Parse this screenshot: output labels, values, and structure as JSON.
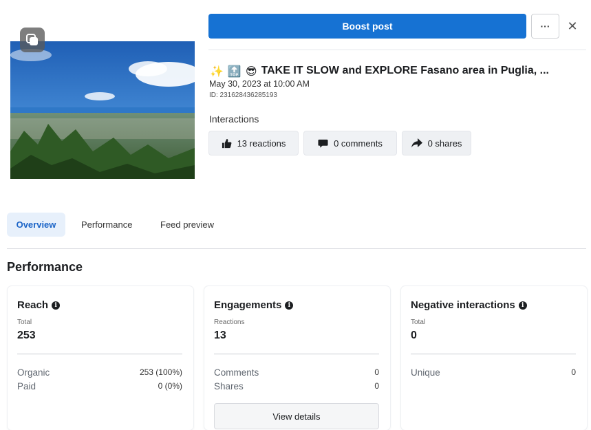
{
  "actions": {
    "boost_label": "Boost post",
    "more_label": "···",
    "close_label": "✕"
  },
  "post": {
    "emojis": [
      "✨",
      "🔝",
      "😎"
    ],
    "title": "TAKE IT SLOW and EXPLORE Fasano area in Puglia, ...",
    "date": "May 30, 2023 at 10:00 AM",
    "id": "ID: 231628436285193",
    "interactions_label": "Interactions",
    "reactions": "13 reactions",
    "comments": "0 comments",
    "shares": "0 shares"
  },
  "tabs": [
    {
      "label": "Overview",
      "active": true
    },
    {
      "label": "Performance",
      "active": false
    },
    {
      "label": "Feed preview",
      "active": false
    }
  ],
  "performance": {
    "title": "Performance",
    "reach": {
      "title": "Reach",
      "sub": "Total",
      "value": "253",
      "rows": [
        {
          "label": "Organic",
          "value": "253 (100%)"
        },
        {
          "label": "Paid",
          "value": "0 (0%)"
        }
      ]
    },
    "engagements": {
      "title": "Engagements",
      "sub": "Reactions",
      "value": "13",
      "rows": [
        {
          "label": "Comments",
          "value": "0"
        },
        {
          "label": "Shares",
          "value": "0"
        }
      ],
      "details_label": "View details"
    },
    "negative": {
      "title": "Negative interactions",
      "sub": "Total",
      "value": "0",
      "rows": [
        {
          "label": "Unique",
          "value": "0"
        }
      ]
    }
  },
  "colors": {
    "brand_blue": "#1672d3",
    "active_tab_bg": "#e7f0fb",
    "active_tab_text": "#1b64c7"
  },
  "icons": {
    "gallery": "multiple-photos-icon",
    "reactions": "thumbs-up-icon",
    "comments": "comment-bubble-icon",
    "shares": "share-arrow-icon",
    "info": "info-icon"
  }
}
